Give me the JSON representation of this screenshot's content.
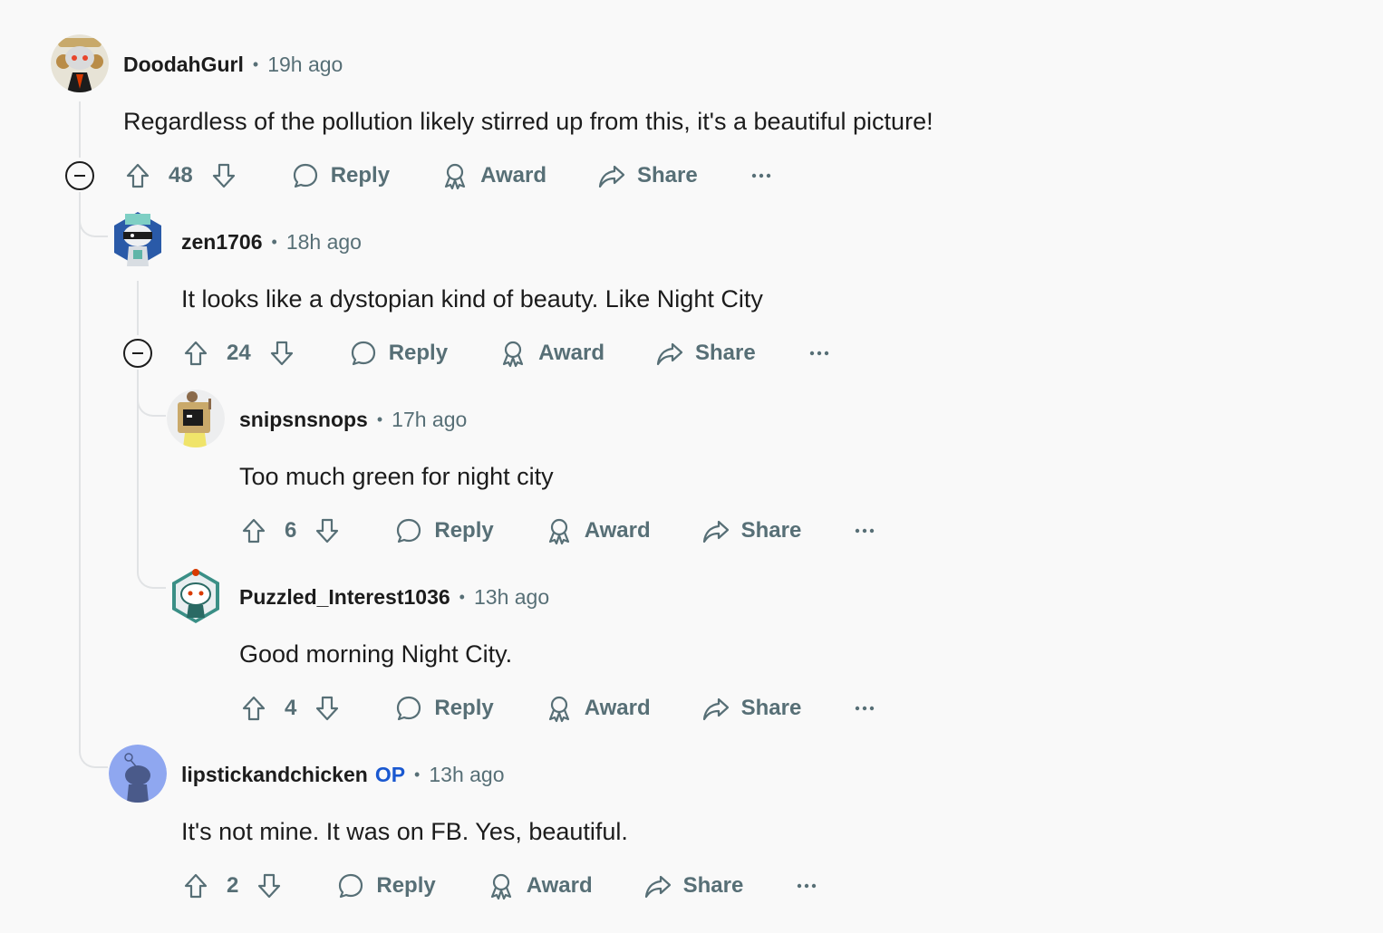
{
  "comments": [
    {
      "author": "DoodahGurl",
      "time": "19h ago",
      "body": "Regardless of the pollution likely stirred up from this, it's a beautiful picture!",
      "score": "48",
      "reply": "Reply",
      "award": "Award",
      "share": "Share"
    },
    {
      "author": "zen1706",
      "time": "18h ago",
      "body": "It looks like a dystopian kind of beauty. Like Night City",
      "score": "24",
      "reply": "Reply",
      "award": "Award",
      "share": "Share"
    },
    {
      "author": "snipsnsnops",
      "time": "17h ago",
      "body": "Too much green for night city",
      "score": "6",
      "reply": "Reply",
      "award": "Award",
      "share": "Share"
    },
    {
      "author": "Puzzled_Interest1036",
      "time": "13h ago",
      "body": "Good morning Night City.",
      "score": "4",
      "reply": "Reply",
      "award": "Award",
      "share": "Share"
    },
    {
      "author": "lipstickandchicken",
      "op_badge": "OP",
      "time": "13h ago",
      "body": "It's not mine. It was on FB. Yes, beautiful.",
      "score": "2",
      "reply": "Reply",
      "award": "Award",
      "share": "Share"
    }
  ],
  "separator": "•",
  "colors": {
    "text": "#1c1c1c",
    "muted": "#576f76",
    "op": "#1a58d0",
    "thread_line": "#e1e3e5",
    "background": "#f9f9f9"
  },
  "icons": [
    "upvote-icon",
    "downvote-icon",
    "comment-icon",
    "award-icon",
    "share-icon",
    "more-icon",
    "collapse-icon"
  ]
}
